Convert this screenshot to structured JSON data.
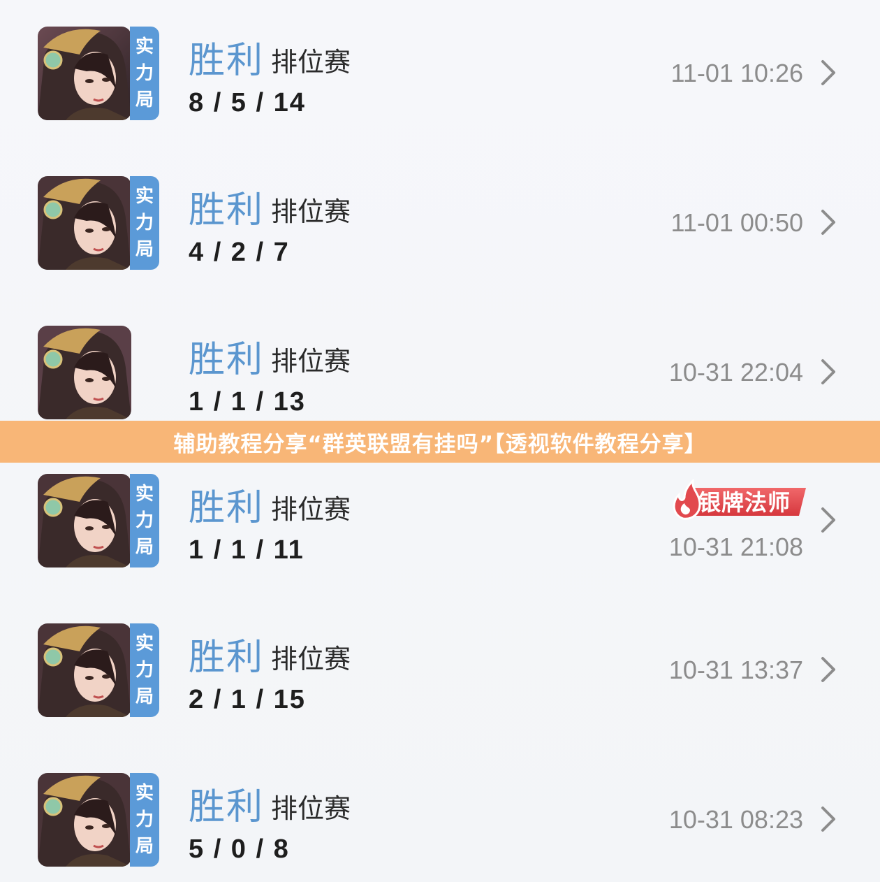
{
  "matches": [
    {
      "result": "胜利",
      "mode": "排位赛",
      "kda": "8 / 5 / 14",
      "time": "11-01 10:26",
      "tag": [
        "实",
        "力",
        "局"
      ],
      "badge": ""
    },
    {
      "result": "胜利",
      "mode": "排位赛",
      "kda": "4 / 2 / 7",
      "time": "11-01 00:50",
      "tag": [
        "实",
        "力",
        "局"
      ],
      "badge": ""
    },
    {
      "result": "胜利",
      "mode": "排位赛",
      "kda": "1 / 1 / 13",
      "time": "10-31 22:04",
      "tag": [],
      "badge": ""
    },
    {
      "result": "胜利",
      "mode": "排位赛",
      "kda": "1 / 1 / 11",
      "time": "10-31 21:08",
      "tag": [
        "实",
        "力",
        "局"
      ],
      "badge": "银牌法师"
    },
    {
      "result": "胜利",
      "mode": "排位赛",
      "kda": "2 / 1 / 15",
      "time": "10-31 13:37",
      "tag": [
        "实",
        "力",
        "局"
      ],
      "badge": ""
    },
    {
      "result": "胜利",
      "mode": "排位赛",
      "kda": "5 / 0 / 8",
      "time": "10-31 08:23",
      "tag": [
        "实",
        "力",
        "局"
      ],
      "badge": ""
    }
  ],
  "banner": {
    "text": "辅助教程分享“群英联盟有挂吗”【透视软件教程分享】"
  },
  "colors": {
    "result": "#5b96cf",
    "tag": "#5b9ad8",
    "banner": "#f8b677",
    "badge": "#e2494e"
  },
  "icons": {
    "row_arrow": "chevron-right-icon",
    "avatar": "hero-portrait-avatar",
    "badge_flame": "flame-icon"
  }
}
